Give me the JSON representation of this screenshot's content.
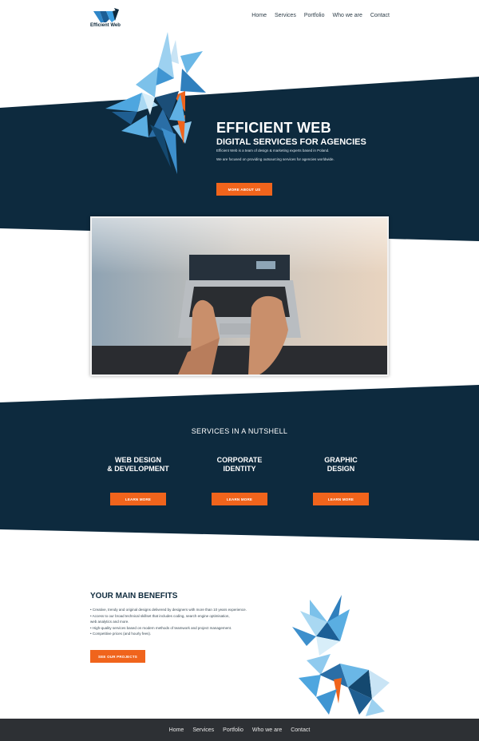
{
  "brand": {
    "name": "Efficient Web",
    "colors": {
      "navy": "#0d2a3e",
      "orange": "#f0641c",
      "footer": "#2d3034",
      "star_blue": "#4a9fd8"
    }
  },
  "nav": [
    "Home",
    "Services",
    "Portfolio",
    "Who we are",
    "Contact"
  ],
  "hero": {
    "title": "EFFICIENT WEB",
    "subtitle": "DIGITAL SERVICES FOR AGENCIES",
    "line1": "Efficient Web is a team of design & marketing experts based in Poland.",
    "line2": "We are focused on providing outsourcing services for agencies worldwide.",
    "button": "MORE ABOUT US"
  },
  "services": {
    "heading": "SERVICES IN A NUTSHELL",
    "items": [
      {
        "line1": "WEB DESIGN",
        "line2": "& DEVELOPMENT",
        "button": "LEARN MORE"
      },
      {
        "line1": "CORPORATE",
        "line2": "IDENTITY",
        "button": "LEARN MORE"
      },
      {
        "line1": "GRAPHIC",
        "line2": "DESIGN",
        "button": "LEARN MORE"
      }
    ]
  },
  "benefits": {
    "title": "YOUR MAIN BENEFITS",
    "items": [
      "• Creative, trendy and original designs delivered by designers with more than 10 years experience.",
      "• Access to our broad technical skillset that includes coding, search engine optimisation,",
      "   web analytics and more.",
      "• High-quality services based on modern methods of teamwork and project management.",
      "• Competitive prices (and hourly fees)."
    ],
    "button": "SEE OUR PROJECTS"
  },
  "footer_nav": [
    "Home",
    "Services",
    "Portfolio",
    "Who we are",
    "Contact"
  ]
}
